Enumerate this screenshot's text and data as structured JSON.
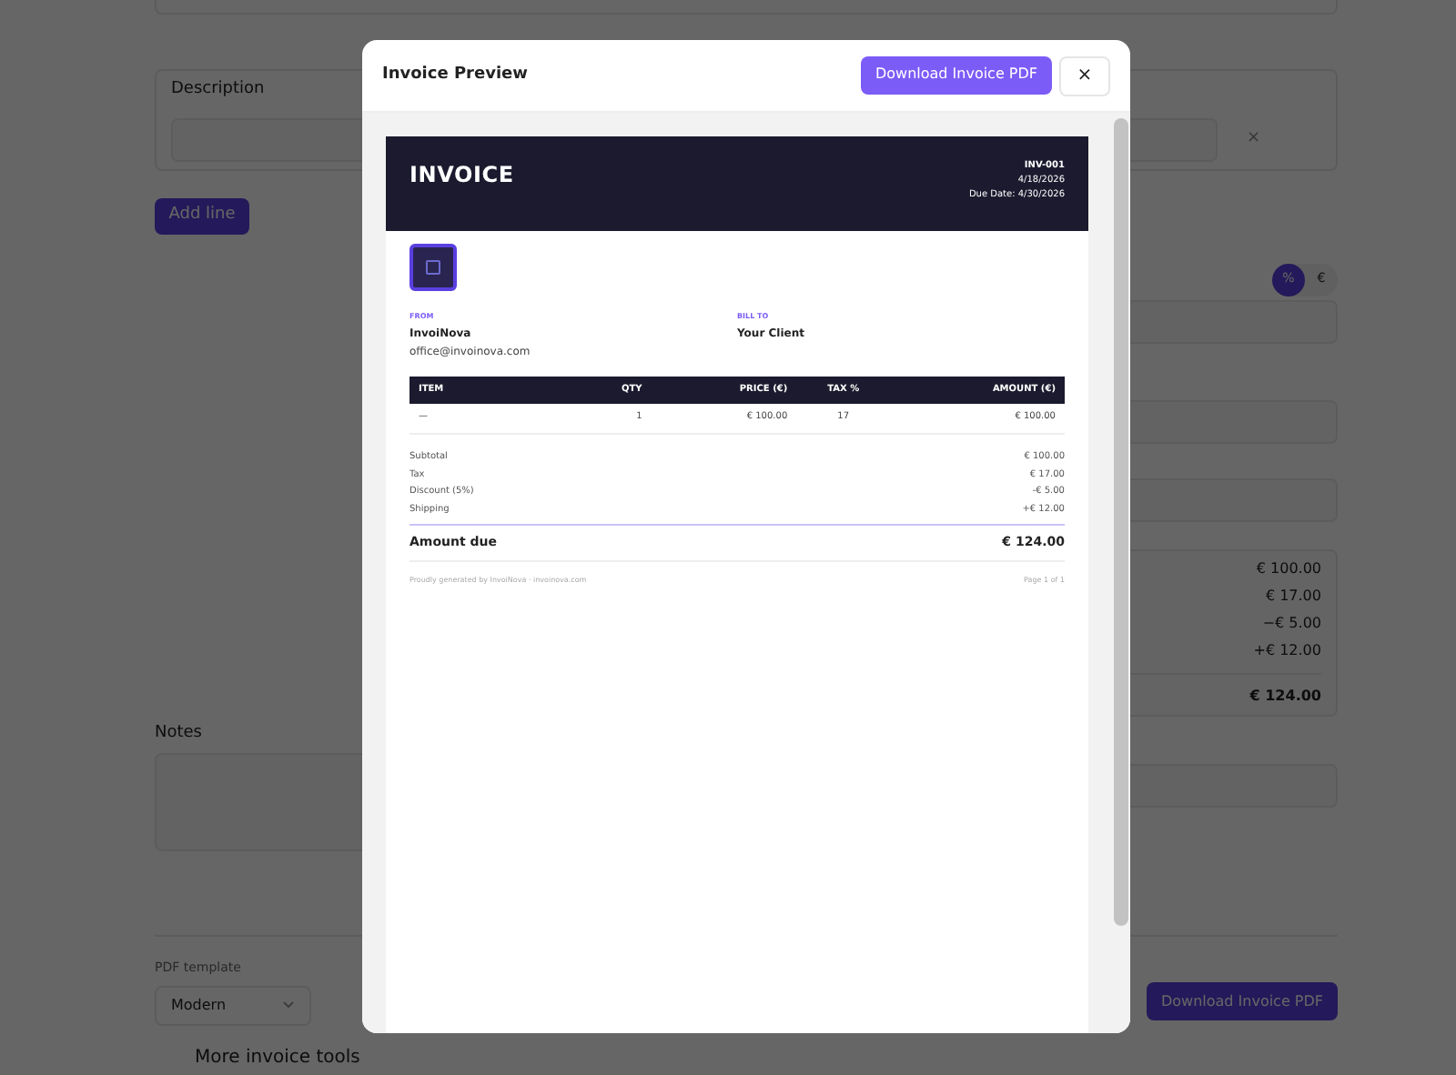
{
  "page": {
    "description_label": "Description",
    "remove_icon": "×",
    "add_line_button": "Add line",
    "discount_toggle": [
      {
        "label": "%",
        "selected": true
      },
      {
        "label": "€",
        "selected": false
      }
    ],
    "totals": [
      "€ 100.00",
      "€ 17.00",
      "−€ 5.00",
      "+€ 12.00"
    ],
    "total_due": "€ 124.00",
    "notes_label": "Notes",
    "pdf_template_label": "PDF template",
    "pdf_template_value": "Modern",
    "download_button": "Download Invoice PDF",
    "more_tools": "More invoice tools"
  },
  "modal": {
    "title": "Invoice Preview",
    "download_button": "Download Invoice PDF",
    "close": "×",
    "invoice": {
      "title": "INVOICE",
      "number": "INV-001",
      "date": "4/18/2026",
      "due_date": "Due Date: 4/30/2026",
      "from_label": "FROM",
      "from_name": "InvoiNova",
      "from_email": "office@invoinova.com",
      "bill_to_label": "BILL TO",
      "bill_to_name": "Your Client",
      "columns": [
        "ITEM",
        "QTY",
        "PRICE (€)",
        "TAX %",
        "AMOUNT (€)"
      ],
      "rows": [
        [
          "—",
          "1",
          "€ 100.00",
          "17",
          "€ 100.00"
        ]
      ],
      "summary": [
        {
          "label": "Subtotal",
          "value": "€ 100.00"
        },
        {
          "label": "Tax",
          "value": "€ 17.00"
        },
        {
          "label": "Discount (5%)",
          "value": "-€ 5.00"
        },
        {
          "label": "Shipping",
          "value": "+€ 12.00"
        }
      ],
      "amount_due_label": "Amount due",
      "amount_due": "€ 124.00",
      "footer": "Proudly generated by InvoiNova · invoinova.com",
      "page": "Page 1 of 1"
    }
  }
}
